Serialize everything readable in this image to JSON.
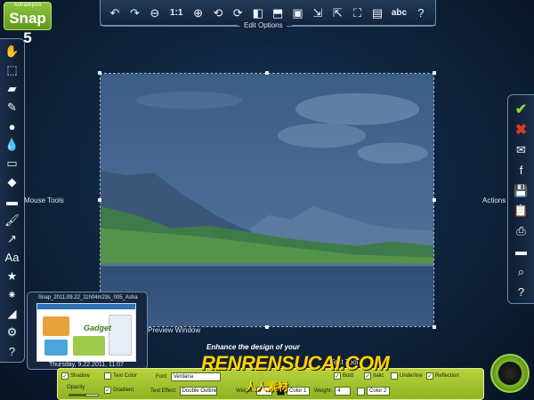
{
  "app": {
    "brand": "Ashampoo",
    "name": "Snap 5"
  },
  "edit_options": {
    "label": "Edit Options",
    "buttons": [
      {
        "name": "undo-icon",
        "glyph": "↶"
      },
      {
        "name": "redo-icon",
        "glyph": "↷"
      },
      {
        "name": "zoom-out-icon",
        "glyph": "⊖"
      },
      {
        "name": "zoom-actual-size-icon",
        "glyph": "1:1"
      },
      {
        "name": "zoom-in-icon",
        "glyph": "⊕"
      },
      {
        "name": "rotate-left-icon",
        "glyph": "⟲"
      },
      {
        "name": "rotate-right-icon",
        "glyph": "⟳"
      },
      {
        "name": "flip-horizontal-icon",
        "glyph": "◧"
      },
      {
        "name": "flip-vertical-icon",
        "glyph": "⬒"
      },
      {
        "name": "image-icon",
        "glyph": "▣"
      },
      {
        "name": "resize-image-icon",
        "glyph": "⇲"
      },
      {
        "name": "resize-canvas-icon",
        "glyph": "⇱"
      },
      {
        "name": "crop-icon",
        "glyph": "⛶"
      },
      {
        "name": "apply-effect-icon",
        "glyph": "▤"
      },
      {
        "name": "ocr-text-icon",
        "glyph": "abc"
      },
      {
        "name": "help-icon",
        "glyph": "?"
      }
    ]
  },
  "mouse_tools": {
    "label": "Mouse Tools",
    "buttons": [
      {
        "name": "hand-icon",
        "glyph": "✋"
      },
      {
        "name": "selection-icon",
        "glyph": "⬚"
      },
      {
        "name": "eraser-icon",
        "glyph": "▰"
      },
      {
        "name": "pen-icon",
        "glyph": "✎"
      },
      {
        "name": "blur-drop-icon",
        "glyph": "●"
      },
      {
        "name": "fill-drop-icon",
        "glyph": "💧"
      },
      {
        "name": "highlight-icon",
        "glyph": "▭"
      },
      {
        "name": "bucket-icon",
        "glyph": "◆"
      },
      {
        "name": "speech-bubble-icon",
        "glyph": "▬"
      },
      {
        "name": "brush-icon",
        "glyph": "🖌"
      },
      {
        "name": "arrow-icon",
        "glyph": "↗"
      },
      {
        "name": "text-icon",
        "glyph": "Aa"
      },
      {
        "name": "stamp-icon",
        "glyph": "★"
      },
      {
        "name": "numbering-icon",
        "glyph": "⁕"
      },
      {
        "name": "ink-icon",
        "glyph": "◢"
      },
      {
        "name": "settings-icon",
        "glyph": "⚙"
      },
      {
        "name": "help-icon",
        "glyph": "?"
      }
    ]
  },
  "actions": {
    "label": "Actions",
    "buttons": [
      {
        "name": "accept-icon",
        "glyph": "✔",
        "kind": "ok"
      },
      {
        "name": "cancel-icon",
        "glyph": "✖",
        "kind": "cancel"
      },
      {
        "name": "email-icon",
        "glyph": "✉",
        "kind": ""
      },
      {
        "name": "facebook-icon",
        "glyph": "f",
        "kind": ""
      },
      {
        "name": "save-icon",
        "glyph": "💾",
        "kind": ""
      },
      {
        "name": "clipboard-icon",
        "glyph": "📋",
        "kind": ""
      },
      {
        "name": "print-icon",
        "glyph": "⎙",
        "kind": ""
      },
      {
        "name": "folder-icon",
        "glyph": "▬",
        "kind": ""
      },
      {
        "name": "search-icon",
        "glyph": "⌕",
        "kind": ""
      },
      {
        "name": "help-icon",
        "glyph": "?",
        "kind": ""
      }
    ]
  },
  "preview": {
    "label": "Preview Window",
    "filename": "Snap_2011.09.22_11h04m23s_005_Asha",
    "date": "Thursday, 9.22.2011, 11:07",
    "thumb_title": "Gadget"
  },
  "text_tool": {
    "label": "Text Tool",
    "shadow": {
      "label": "Shadow",
      "checked": true
    },
    "text_color": {
      "label": "Text Color",
      "checked": false
    },
    "font": {
      "label": "Font:",
      "value": "Verdana"
    },
    "bold": {
      "label": "Bold",
      "checked": true
    },
    "italic": {
      "label": "Italic",
      "checked": true
    },
    "underline": {
      "label": "Underline",
      "checked": false
    },
    "reflection": {
      "label": "Reflection",
      "checked": true
    },
    "opacity": {
      "label": "Opacity",
      "value": 0.6
    },
    "gradient": {
      "label": "Gradient",
      "checked": true
    },
    "text_effect": {
      "label": "Text Effect:",
      "value": "Double Outline"
    },
    "weight1": {
      "label": "Weight:",
      "value": "7"
    },
    "color1": {
      "label": "Color 1",
      "swatch": "#111111"
    },
    "weight2": {
      "label": "Weight:",
      "value": "4"
    },
    "color2": {
      "label": "Color 2",
      "swatch": "#ffffff"
    }
  },
  "watermark": {
    "tag": "Enhance the design of your",
    "site": "RENRENSUCAI.COM",
    "chinese": "人人素材"
  },
  "colors": {
    "accent_green": "#8ec63f",
    "panel_border": "#6c8bb0",
    "ok": "#8ed634",
    "cancel": "#e03a2a"
  }
}
